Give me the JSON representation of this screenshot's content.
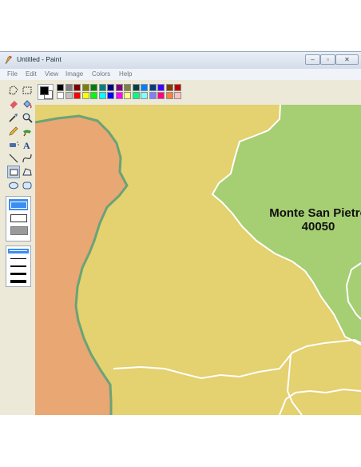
{
  "window": {
    "title": "Untitled - Paint",
    "app_icon": "paint-icon",
    "minimize_icon": "minimize-icon",
    "maximize_icon": "maximize-icon",
    "close_icon": "close-icon"
  },
  "menu": [
    "File",
    "Edit",
    "View",
    "Image",
    "Colors",
    "Help"
  ],
  "tools": [
    "free-select-icon",
    "rect-select-icon",
    "eraser-icon",
    "fill-icon",
    "color-picker-icon",
    "magnifier-icon",
    "pencil-icon",
    "brush-icon",
    "airbrush-icon",
    "text-icon",
    "line-icon",
    "curve-icon",
    "rectangle-icon",
    "polygon-icon",
    "ellipse-icon",
    "rounded-rect-icon"
  ],
  "selected_tool": "rectangle-icon",
  "colors": {
    "foreground": "#000000",
    "background": "#ffffff",
    "palette_row1": [
      "#000000",
      "#808080",
      "#800000",
      "#808000",
      "#008000",
      "#008080",
      "#000080",
      "#800080",
      "#808040",
      "#004040",
      "#0080ff",
      "#004080",
      "#4000ff",
      "#804000",
      "#c00000"
    ],
    "palette_row2": [
      "#ffffff",
      "#c0c0c0",
      "#ff0000",
      "#ffff00",
      "#00ff00",
      "#00ffff",
      "#0000ff",
      "#ff00ff",
      "#ffff80",
      "#00ff80",
      "#80ffff",
      "#8080ff",
      "#ff0080",
      "#ff8040",
      "#ffc0c0"
    ],
    "map_orange": "#e8a773",
    "map_yellow": "#e4d16f",
    "map_green": "#a5cf72",
    "border_green": "#6aa377",
    "border_white": "#ffffff"
  },
  "map": {
    "region_name": "Monte San Pietro",
    "region_code": "40050"
  }
}
